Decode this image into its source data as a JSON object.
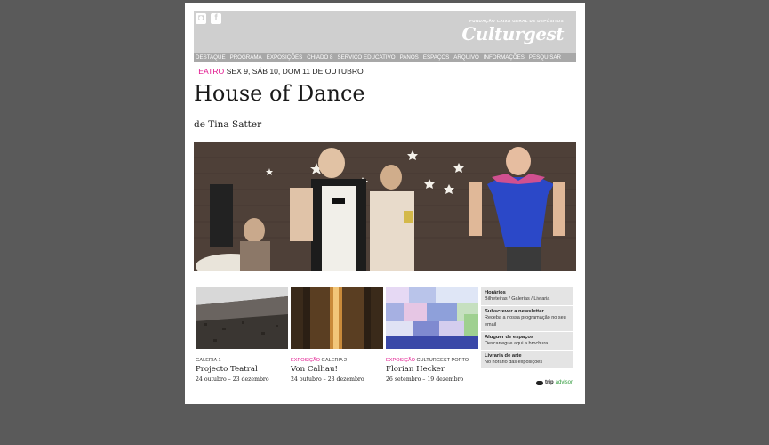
{
  "header": {
    "social": [
      {
        "name": "instagram-icon"
      },
      {
        "name": "facebook-icon"
      }
    ],
    "foundation": "FUNDAÇÃO CAIXA GERAL DE DEPÓSITOS",
    "logo": "Culturgest"
  },
  "nav": [
    "DESTAQUE",
    "PROGRAMA",
    "EXPOSIÇÕES",
    "CHIADO 8",
    "SERVIÇO EDUCATIVO",
    "PANOS",
    "ESPAÇOS",
    "ARQUIVO",
    "INFORMAÇÕES",
    "PESQUISAR"
  ],
  "event": {
    "category": "TEATRO",
    "dates": "SEX 9, SÁB 10, DOM 11 DE OUTUBRO",
    "title": "House of Dance",
    "author": "de Tina Satter"
  },
  "cards": [
    {
      "category": "",
      "place": "GALERIA 1",
      "title": "Projecto Teatral",
      "dates": "24 outubro – 23 dezembro"
    },
    {
      "category": "EXPOSIÇÃO",
      "place": "GALERIA 2",
      "title": "Von Calhau!",
      "dates": "24 outubro – 23 dezembro"
    },
    {
      "category": "EXPOSIÇÃO",
      "place": "CULTURGEST PORTO",
      "title": "Florian Hecker",
      "dates": "26 setembro – 19 dezembro"
    }
  ],
  "info": [
    {
      "title": "Horários",
      "sub": "Bilheteiras / Galerias / Livraria"
    },
    {
      "title": "Subscrever a newsletter",
      "sub": "Receba a nossa programação no seu email"
    },
    {
      "title": "Aluguer de espaços",
      "sub": "Descarregue aqui a brochura"
    },
    {
      "title": "Livraria de arte",
      "sub": "No horário das exposições"
    }
  ],
  "tripadvisor": {
    "part1": "trip",
    "part2": "advisor"
  },
  "colors": {
    "accent": "#e0138c",
    "background": "#5a5a5a",
    "masthead": "#cfcfcf",
    "nav": "#a8a8a8"
  }
}
